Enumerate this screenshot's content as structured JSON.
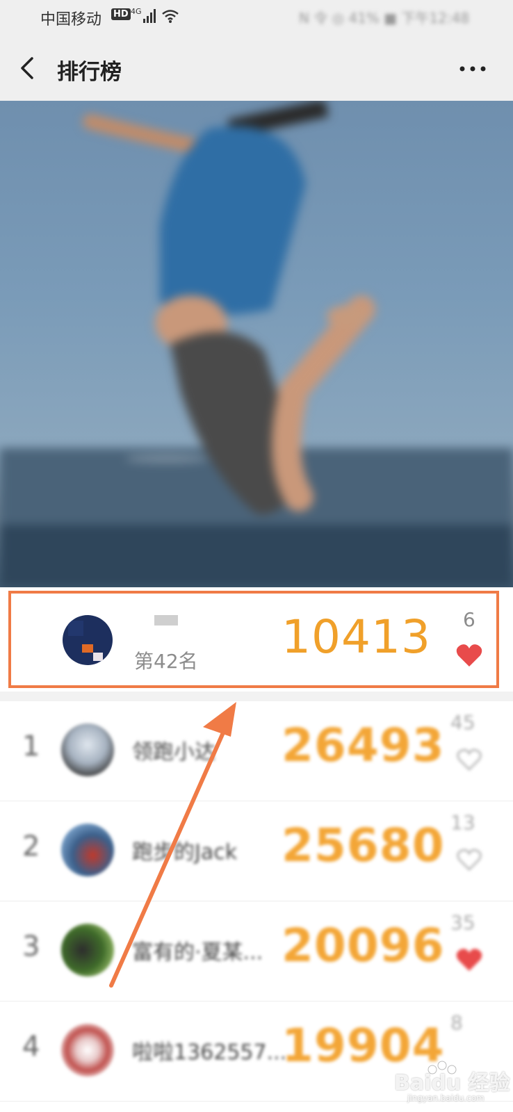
{
  "status_bar": {
    "carrier": "中国移动",
    "hd_badge": "HD",
    "network": "4G",
    "right_text": "N 令 ◎ 41% ■ 下午12:48"
  },
  "header": {
    "title": "排行榜",
    "back_icon": "chevron-left-icon",
    "more_icon": "more-horizontal-icon"
  },
  "my_rank": {
    "rank_label": "第42名",
    "score": "10413",
    "likes": "6",
    "liked": true
  },
  "ranking": [
    {
      "rank": "1",
      "name": "领跑小达",
      "score": "26493",
      "likes": "45",
      "liked": false
    },
    {
      "rank": "2",
      "name": "跑步的Jack",
      "score": "25680",
      "likes": "13",
      "liked": false
    },
    {
      "rank": "3",
      "name": "富有的·夏某...",
      "score": "20096",
      "likes": "35",
      "liked": true
    },
    {
      "rank": "4",
      "name": "啦啦1362557...",
      "score": "19904",
      "likes": "8",
      "liked": false
    }
  ],
  "watermark": {
    "brand": "Baidu 经验",
    "url": "jingyan.baidu.com"
  },
  "colors": {
    "accent_orange": "#f0a02a",
    "highlight_border": "#f07b46",
    "heart_red": "#e84b4b"
  }
}
